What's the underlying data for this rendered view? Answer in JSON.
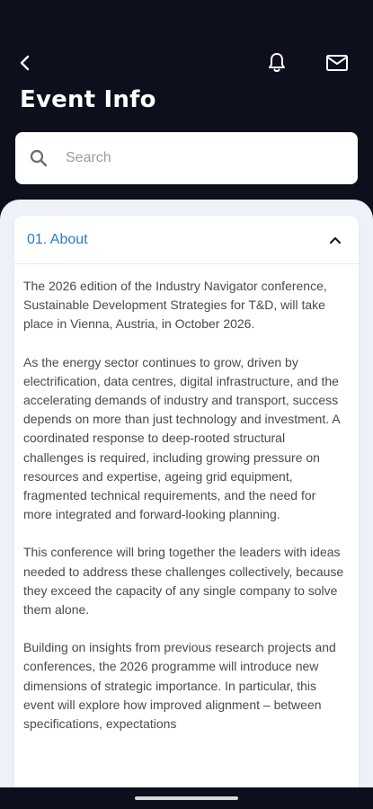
{
  "header": {
    "title": "Event Info"
  },
  "search": {
    "placeholder": "Search"
  },
  "icons": {
    "back": "chevron-left-icon",
    "notifications": "bell-icon",
    "messages": "mail-icon",
    "search": "search-icon",
    "collapse": "chevron-up-icon"
  },
  "colors": {
    "background": "#0e0f1d",
    "accent": "#2a7bc4",
    "sheet": "#eef1f8"
  },
  "section": {
    "title": "01. About",
    "paragraphs": [
      "The 2026 edition of the Industry Navigator conference, Sustainable Development Strategies for T&D, will take place in Vienna, Austria, in October 2026.",
      "As the energy sector continues to grow, driven by electrification, data centres, digital infrastructure, and the accelerating demands of industry and transport, success depends on more than just technology and investment. A coordinated response to deep-rooted structural challenges is required, including growing pressure on resources and expertise, ageing grid equipment, fragmented technical requirements, and the need for more integrated and forward-looking planning.",
      "This conference will bring together the leaders with ideas needed to address these challenges collectively, because they exceed the capacity of any single company to solve them alone.",
      "Building on insights from previous research projects and conferences, the 2026 programme will introduce new dimensions of strategic importance. In particular, this event will explore how improved alignment – between specifications, expectations"
    ]
  }
}
